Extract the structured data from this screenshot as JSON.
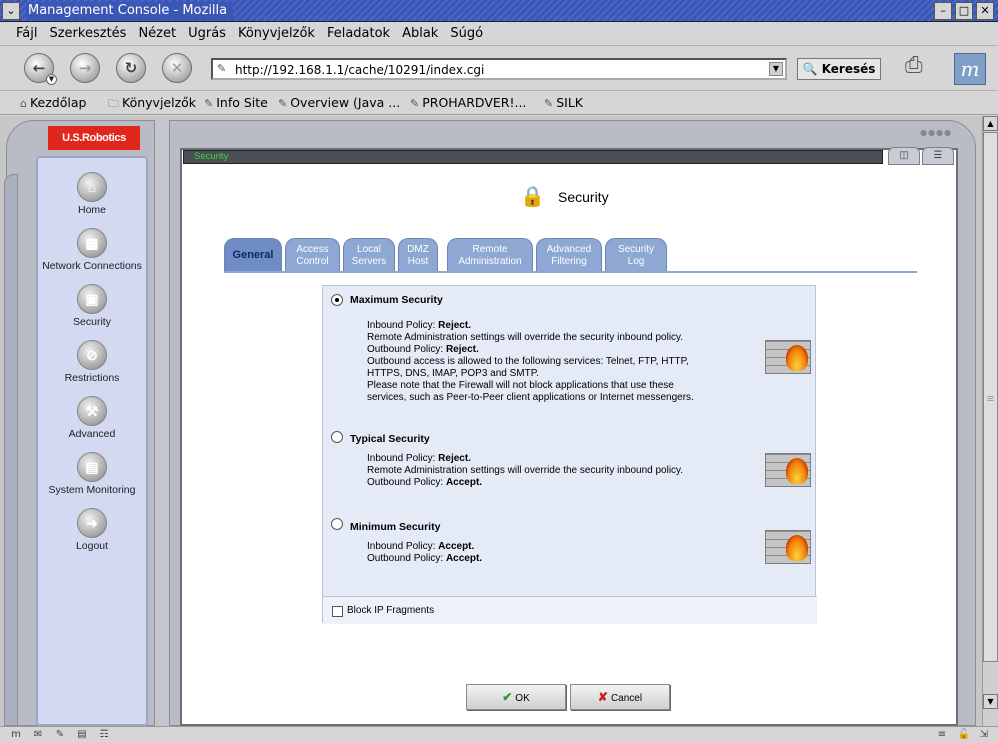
{
  "window": {
    "title": "Management Console - Mozilla"
  },
  "menu": [
    "Fájl",
    "Szerkesztés",
    "Nézet",
    "Ugrás",
    "Könyvjelzők",
    "Feladatok",
    "Ablak",
    "Súgó"
  ],
  "nav": {
    "url": "http://192.168.1.1/cache/10291/index.cgi",
    "search_label": "Keresés"
  },
  "bookmarks": [
    "Kezdőlap",
    "Könyvjelzők",
    "Info Site",
    "Overview (Java ...",
    "PROHARDVER!...",
    "SILK"
  ],
  "router": {
    "brand": "U.S.Robotics",
    "status_strip": "Security",
    "sidebar": [
      "Home",
      "Network Connections",
      "Security",
      "Restrictions",
      "Advanced",
      "System Monitoring",
      "Logout"
    ]
  },
  "page": {
    "title": "Security",
    "tabs": [
      {
        "l1": "General",
        "l2": ""
      },
      {
        "l1": "Access",
        "l2": "Control"
      },
      {
        "l1": "Local",
        "l2": "Servers"
      },
      {
        "l1": "DMZ",
        "l2": "Host"
      },
      {
        "l1": "Remote",
        "l2": "Administration"
      },
      {
        "l1": "Advanced",
        "l2": "Filtering"
      },
      {
        "l1": "Security",
        "l2": "Log"
      }
    ],
    "selected_option": "maximum"
  },
  "options": {
    "maximum": {
      "title": "Maximum Security",
      "inbound_label": "Inbound Policy:",
      "inbound_value": "Reject.",
      "remote_note": "Remote Administration settings will override the security inbound policy.",
      "outbound_label": "Outbound Policy:",
      "outbound_value": "Reject.",
      "services_line1": "Outbound access is allowed to the following services: Telnet, FTP, HTTP,",
      "services_line2": "HTTPS, DNS, IMAP, POP3 and SMTP.",
      "note_line1": "Please note that the Firewall will not block applications that use these",
      "note_line2": "services, such as Peer-to-Peer client applications or Internet messengers."
    },
    "typical": {
      "title": "Typical Security",
      "inbound_label": "Inbound Policy:",
      "inbound_value": "Reject.",
      "remote_note": "Remote Administration settings will override the security inbound policy.",
      "outbound_label": "Outbound Policy:",
      "outbound_value": "Accept."
    },
    "minimum": {
      "title": "Minimum Security",
      "inbound_label": "Inbound Policy:",
      "inbound_value": "Accept.",
      "outbound_label": "Outbound Policy:",
      "outbound_value": "Accept."
    },
    "block_ip_fragments": {
      "label": "Block IP Fragments",
      "checked": false
    }
  },
  "buttons": {
    "ok": "OK",
    "cancel": "Cancel"
  },
  "colors": {
    "brand_red": "#e1261c",
    "tab_blue": "#8ea7d3",
    "status_green": "#3fd33f"
  }
}
